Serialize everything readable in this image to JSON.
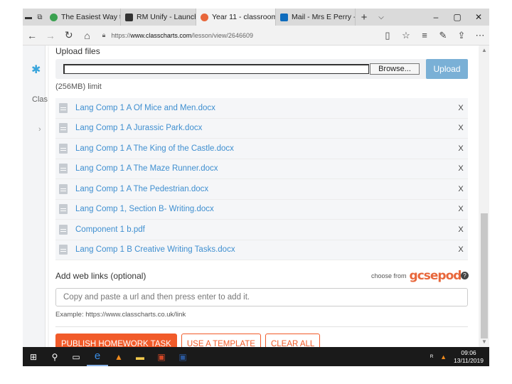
{
  "browser": {
    "tabs": [
      {
        "title": "The Easiest Way to Take",
        "color": "#3aa150"
      },
      {
        "title": "RM Unify - Launch Pad",
        "color": "#333333"
      },
      {
        "title": "Year 11 - classroom",
        "color": "#e8673b"
      },
      {
        "title": "Mail - Mrs E Perry - Out",
        "color": "#0f6cbd"
      }
    ],
    "url_prefix": "https://",
    "url_domain": "www.classcharts.com",
    "url_path": "/lesson/view/2646609"
  },
  "background": {
    "partial_label": "Clas"
  },
  "upload": {
    "title": "Upload files",
    "browse_label": "Browse...",
    "upload_label": "Upload",
    "limit": "(256MB) limit"
  },
  "files": [
    {
      "name": "Lang Comp 1 A Of Mice and Men.docx",
      "remove": "X"
    },
    {
      "name": "Lang Comp 1 A Jurassic Park.docx",
      "remove": "X"
    },
    {
      "name": "Lang Comp 1 A The King of the Castle.docx",
      "remove": "X"
    },
    {
      "name": "Lang Comp 1 A The Maze Runner.docx",
      "remove": "X"
    },
    {
      "name": "Lang Comp 1 A The Pedestrian.docx",
      "remove": "X"
    },
    {
      "name": "Lang Comp 1, Section B- Writing.docx",
      "remove": "X"
    },
    {
      "name": "Component 1 b.pdf",
      "remove": "X"
    },
    {
      "name": "Lang Comp 1 B Creative Writing Tasks.docx",
      "remove": "X"
    }
  ],
  "weblinks": {
    "title": "Add web links (optional)",
    "choose_from": "choose from",
    "provider_logo_text": "gcsepod",
    "help": "?",
    "placeholder": "Copy and paste a url and then press enter to add it.",
    "example": "Example: https://www.classcharts.co.uk/link"
  },
  "actions": {
    "publish": "PUBLISH HOMEWORK TASK",
    "template": "USE A TEMPLATE",
    "clear": "CLEAR ALL"
  },
  "taskbar": {
    "time": "09:06",
    "date": "13/11/2019"
  },
  "colors": {
    "accent": "#f15b2a",
    "link": "#3f8fd0",
    "upload_button": "#7ab0d6"
  }
}
